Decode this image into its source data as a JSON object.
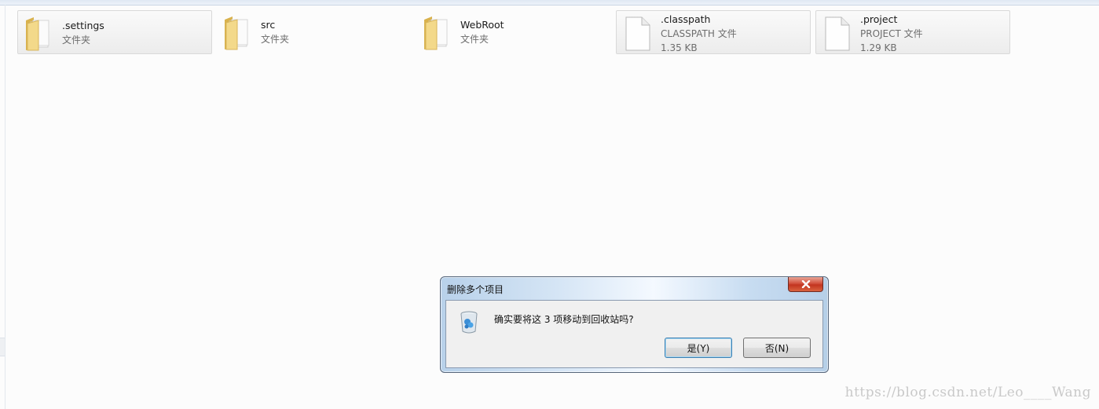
{
  "items": [
    {
      "name": ".settings",
      "type": "文件夹",
      "kind": "folder",
      "selected": true,
      "icon": "folder-icon"
    },
    {
      "name": "src",
      "type": "文件夹",
      "kind": "folder",
      "selected": false,
      "icon": "folder-icon"
    },
    {
      "name": "WebRoot",
      "type": "文件夹",
      "kind": "folder",
      "selected": false,
      "icon": "folder-icon"
    },
    {
      "name": ".classpath",
      "type": "CLASSPATH 文件",
      "size": "1.35 KB",
      "kind": "file",
      "selected": true,
      "icon": "file-icon"
    },
    {
      "name": ".project",
      "type": "PROJECT 文件",
      "size": "1.29 KB",
      "kind": "file",
      "selected": true,
      "icon": "file-icon"
    }
  ],
  "dialog": {
    "title": "删除多个项目",
    "message": "确实要将这 3 项移动到回收站吗?",
    "yes_label": "是(Y)",
    "no_label": "否(N)",
    "icon": "recycle-bin-icon"
  },
  "watermark": "https://blog.csdn.net/Leo____Wang",
  "colors": {
    "folder": "#f2d57e",
    "close_button": "#c9402b",
    "default_button_border": "#3c7fb1"
  }
}
